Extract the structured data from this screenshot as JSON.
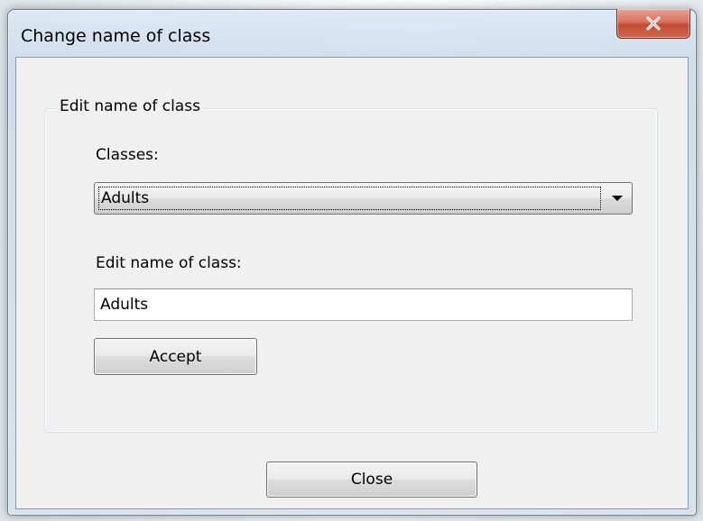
{
  "window": {
    "title": "Change name of class",
    "close_icon": "close-x-icon",
    "close_button_color": "#c9503a"
  },
  "group": {
    "legend": "Edit name of class"
  },
  "classes": {
    "label": "Classes:",
    "selected": "Adults"
  },
  "edit": {
    "label": "Edit name of class:",
    "value": "Adults"
  },
  "buttons": {
    "accept": "Accept",
    "close": "Close"
  }
}
